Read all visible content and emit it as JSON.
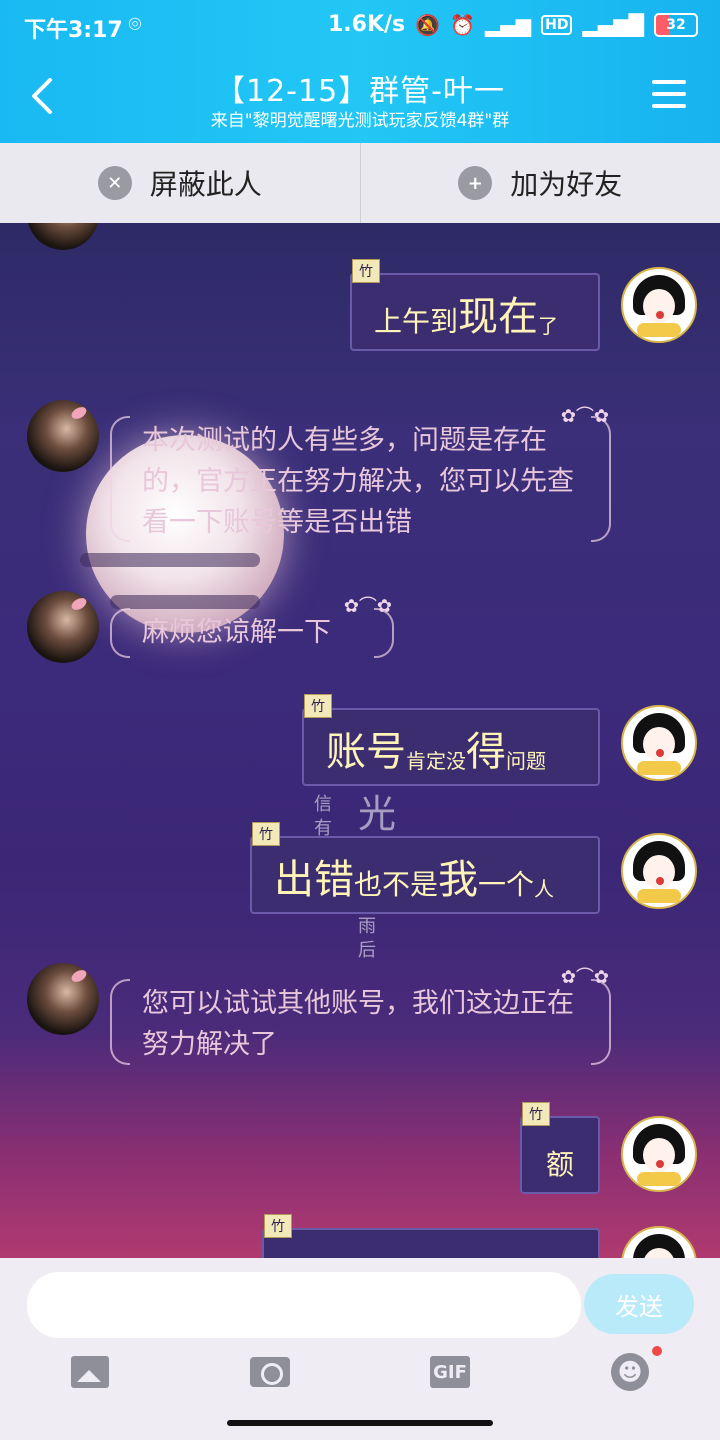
{
  "status": {
    "time": "下午3:17",
    "network_speed": "1.6K/s",
    "battery": "32",
    "battery_fraction": 0.32,
    "icons": [
      "mute-icon",
      "alarm-icon",
      "3g-signal-icon",
      "hd-icon",
      "4g-signal-icon",
      "battery-icon"
    ]
  },
  "header": {
    "title": "【12-15】群管-叶一",
    "subtitle": "来自\"黎明觉醒曙光测试玩家反馈4群\"群",
    "back_icon": "chevron-left-icon",
    "menu_icon": "menu-icon"
  },
  "actions": {
    "block": "屏蔽此人",
    "add_friend": "加为好友"
  },
  "messages": {
    "m1": {
      "tag": "竹",
      "parts": [
        "上午到",
        "现在",
        "了"
      ]
    },
    "m2": {
      "text": "本次测试的人有些多，问题是存在的，官方正在努力解决，您可以先查看一下账号等是否出错"
    },
    "m3": {
      "text": "麻烦您谅解一下"
    },
    "m4": {
      "tag": "竹",
      "parts": [
        "账号",
        "肯定没",
        "得",
        "问题"
      ]
    },
    "m5": {
      "tag": "竹",
      "parts": [
        "出错",
        "也不是",
        "我",
        "一个",
        "人"
      ]
    },
    "m6": {
      "text": "您可以试试其他账号，我们这边正在努力解决了"
    },
    "m7": {
      "tag": "竹",
      "text": "额"
    },
    "m8": {
      "tag": "竹"
    }
  },
  "background_text": {
    "col1": "信 有",
    "col2": "光",
    "col3": "雨 后"
  },
  "input": {
    "value": "",
    "send_label": "发送"
  },
  "colors": {
    "header": "#22c7f5",
    "bubble_text": "#fff4b8",
    "send_button": "#b8eaf9"
  }
}
